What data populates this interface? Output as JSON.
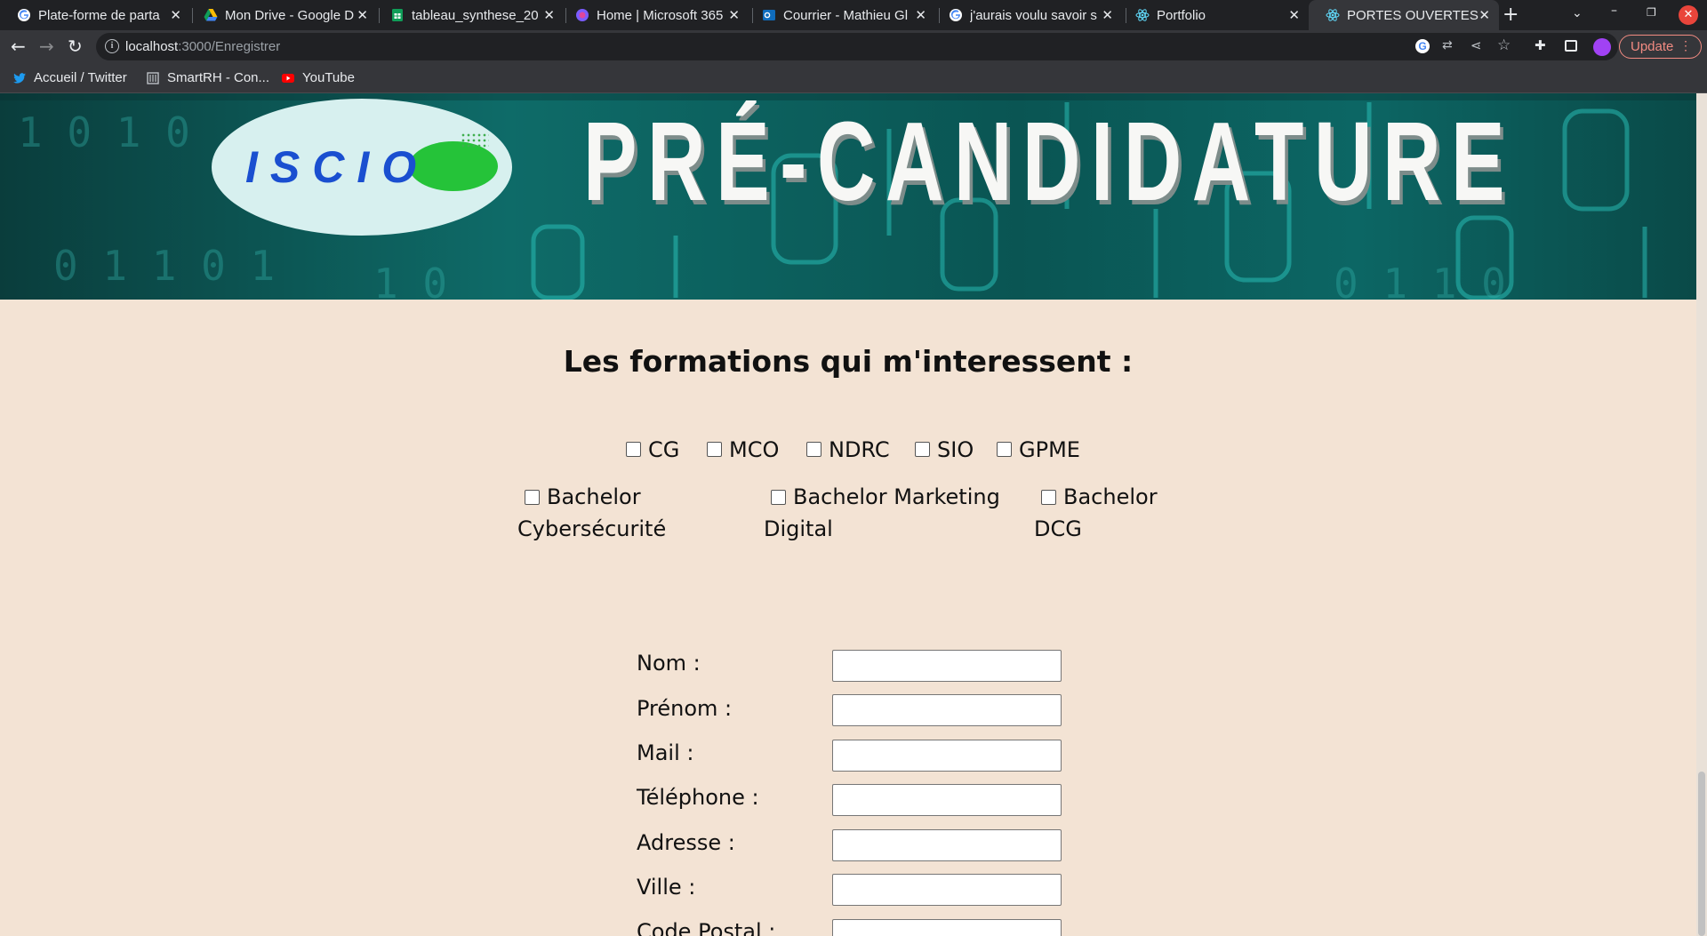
{
  "browser": {
    "tabs": [
      {
        "label": "Plate-forme de parta",
        "icon": "google-icon"
      },
      {
        "label": "Mon Drive - Google D",
        "icon": "google-drive-icon"
      },
      {
        "label": "tableau_synthese_20",
        "icon": "google-sheets-icon"
      },
      {
        "label": "Home | Microsoft 365",
        "icon": "microsoft-365-icon"
      },
      {
        "label": "Courrier - Mathieu Gl",
        "icon": "outlook-icon"
      },
      {
        "label": "j'aurais voulu savoir s",
        "icon": "google-icon"
      },
      {
        "label": "Portfolio",
        "icon": "react-icon"
      },
      {
        "label": "PORTES OUVERTES",
        "icon": "react-icon"
      }
    ],
    "new_tab_symbol": "+",
    "url": {
      "host": "localhost",
      "path": ":3000/Enregistrer"
    },
    "update_label": "Update",
    "bookmarks": [
      {
        "label": "Accueil / Twitter",
        "icon": "twitter-icon"
      },
      {
        "label": "SmartRH - Con...",
        "icon": "smartrh-icon"
      },
      {
        "label": "YouTube",
        "icon": "youtube-icon"
      }
    ]
  },
  "banner": {
    "logo_text": "ISCIO",
    "title": "PRÉ-CANDIDATURE"
  },
  "formations": {
    "title": "Les formations qui m'interessent :",
    "row1": [
      "CG",
      "MCO",
      "NDRC",
      "SIO",
      "GPME"
    ],
    "row2": [
      {
        "line1": "Bachelor",
        "line2": "Cybersécurité"
      },
      {
        "line1": "Bachelor Marketing",
        "line2": "Digital"
      },
      {
        "line1": "Bachelor",
        "line2": "DCG"
      }
    ]
  },
  "form": {
    "fields": [
      {
        "label": "Nom :",
        "value": ""
      },
      {
        "label": "Prénom :",
        "value": ""
      },
      {
        "label": "Mail :",
        "value": ""
      },
      {
        "label": "Téléphone :",
        "value": ""
      },
      {
        "label": "Adresse :",
        "value": ""
      },
      {
        "label": "Ville :",
        "value": ""
      },
      {
        "label": "Code Postal :",
        "value": ""
      }
    ]
  }
}
